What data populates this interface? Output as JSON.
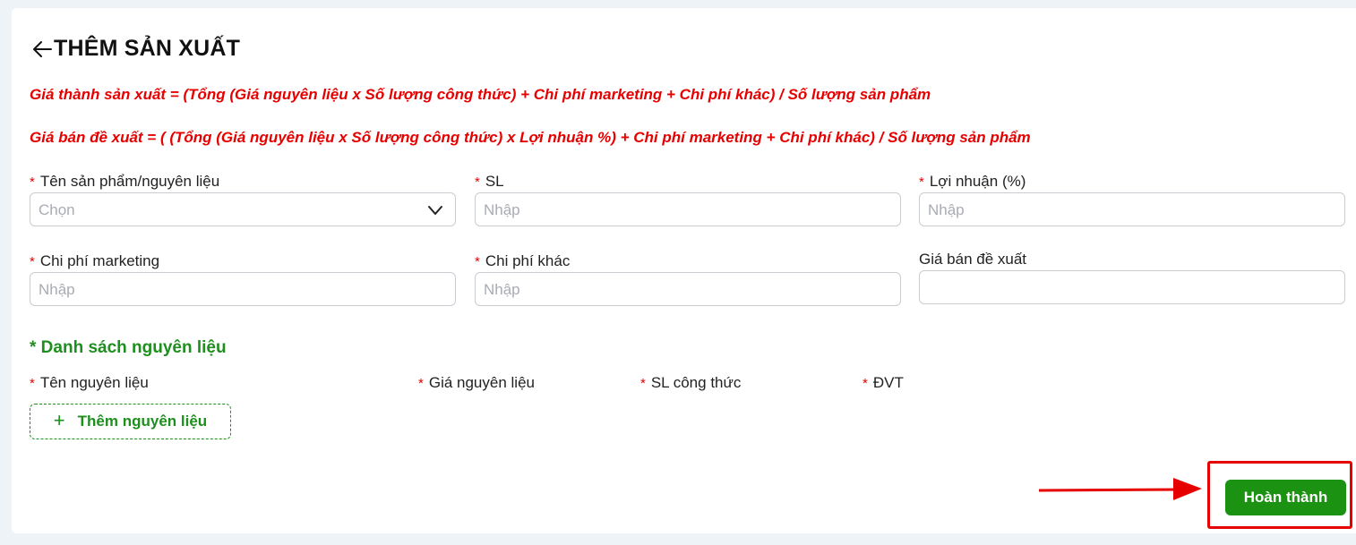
{
  "header": {
    "title": "THÊM SẢN XUẤT"
  },
  "formulas": {
    "cost": "Giá thành sản xuất = (Tổng (Giá nguyên liệu x Số lượng công thức) + Chi phí marketing + Chi phí khác) / Số lượng sản phẩm",
    "price": "Giá bán đề xuất = ( (Tổng (Giá nguyên liệu x Số lượng công thức) x Lợi nhuận %) + Chi phí marketing + Chi phí khác) / Số lượng sản phẩm"
  },
  "form": {
    "required_mark": "*",
    "product": {
      "label": "Tên sản phẩm/nguyên liệu",
      "placeholder": "Chọn"
    },
    "quantity": {
      "label": "SL",
      "placeholder": "Nhập"
    },
    "profit": {
      "label": "Lợi nhuận (%)",
      "placeholder": "Nhập"
    },
    "marketing": {
      "label": "Chi phí marketing",
      "placeholder": "Nhập"
    },
    "other_cost": {
      "label": "Chi phí khác",
      "placeholder": "Nhập"
    },
    "suggested_price": {
      "label": "Giá bán đề xuất",
      "value": ""
    }
  },
  "ingredients": {
    "section_title": "* Danh sách nguyên liệu",
    "columns": [
      "Tên nguyên liệu",
      "Giá nguyên liệu",
      "SL công thức",
      "ĐVT"
    ],
    "add_button": "Thêm nguyên liệu"
  },
  "footer": {
    "submit_label": "Hoàn thành"
  },
  "colors": {
    "accent_green": "#1b9212",
    "required_red": "#e60000",
    "annotation_red": "#e60000"
  },
  "icons": {
    "back": "arrow-left-icon",
    "dropdown": "chevron-down-icon",
    "add": "plus-icon"
  }
}
